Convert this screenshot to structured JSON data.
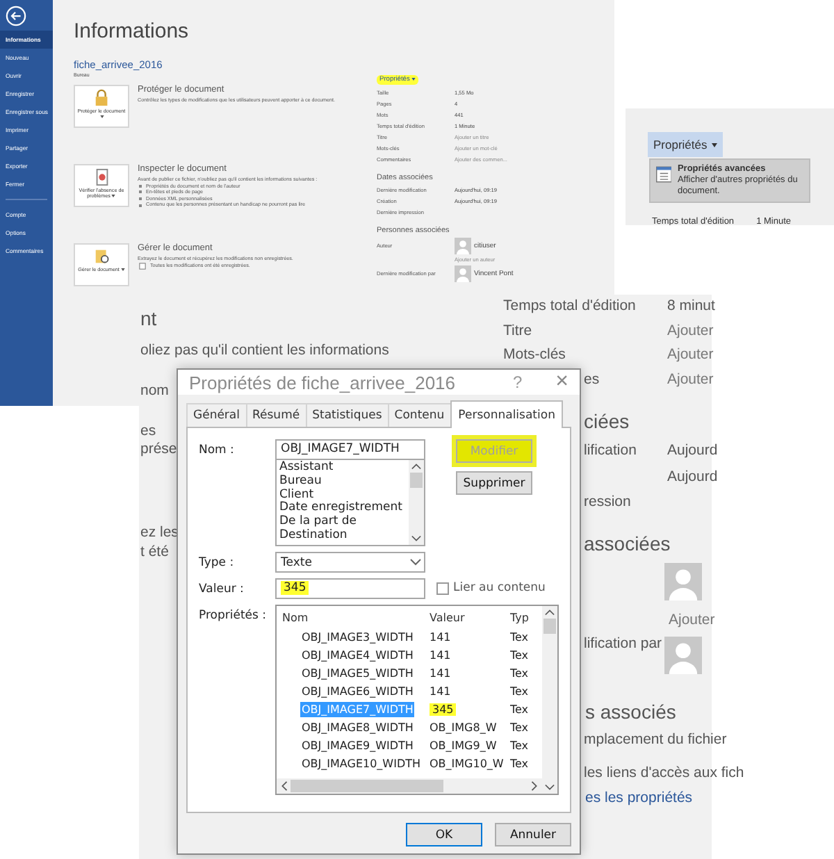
{
  "backstage": {
    "sidebar": {
      "items": [
        {
          "label": "Informations",
          "selected": true
        },
        {
          "label": "Nouveau",
          "selected": false
        },
        {
          "label": "Ouvrir",
          "selected": false
        },
        {
          "label": "Enregistrer",
          "selected": false
        },
        {
          "label": "Enregistrer sous",
          "selected": false
        },
        {
          "label": "Imprimer",
          "selected": false
        },
        {
          "label": "Partager",
          "selected": false
        },
        {
          "label": "Exporter",
          "selected": false
        },
        {
          "label": "Fermer",
          "selected": false
        },
        {
          "label": "Compte",
          "selected": false
        },
        {
          "label": "Options",
          "selected": false
        },
        {
          "label": "Commentaires",
          "selected": false
        }
      ]
    },
    "title": "Informations",
    "file_name": "fiche_arrivee_2016",
    "location": "Bureau",
    "sections": [
      {
        "kind": "protect",
        "button_label": "Protéger le document",
        "heading": "Protéger le document",
        "description": "Contrôlez les types de modifications que les utilisateurs peuvent apporter à ce document."
      },
      {
        "kind": "inspect",
        "button_label": "Vérifier l'absence de problèmes",
        "heading": "Inspecter le document",
        "description": "Avant de publier ce fichier, n'oubliez pas qu'il contient les informations suivantes :",
        "bullets": [
          "Propriétés du document et nom de l'auteur",
          "En-têtes et pieds de page",
          "Données XML personnalisées",
          "Contenu que les personnes présentant un handicap ne pourront pas lire"
        ]
      },
      {
        "kind": "manage",
        "button_label": "Gérer le document",
        "heading": "Gérer le document",
        "description": "Extrayez le document et récupérez les modifications non enregistrées.",
        "note": "Toutes les modifications ont été enregistrées."
      }
    ],
    "properties": {
      "heading": "Propriétés",
      "highlighted": true,
      "rows": [
        {
          "label": "Taille",
          "value": "1,55 Mo",
          "muted": false
        },
        {
          "label": "Pages",
          "value": "4",
          "muted": false
        },
        {
          "label": "Mots",
          "value": "441",
          "muted": false
        },
        {
          "label": "Temps total d'édition",
          "value": "1 Minute",
          "muted": false
        },
        {
          "label": "Titre",
          "value": "Ajouter un titre",
          "muted": true
        },
        {
          "label": "Mots-clés",
          "value": "Ajouter un mot-clé",
          "muted": true
        },
        {
          "label": "Commentaires",
          "value": "Ajouter des commen...",
          "muted": true
        }
      ]
    },
    "dates": {
      "heading": "Dates associées",
      "rows": [
        {
          "label": "Dernière modification",
          "value": "Aujourd'hui, 09:19"
        },
        {
          "label": "Création",
          "value": "Aujourd'hui, 09:19"
        },
        {
          "label": "Dernière impression"
        }
      ]
    },
    "people": {
      "heading": "Personnes associées",
      "author_label": "Auteur",
      "author": "citiuser",
      "add_author": "Ajouter un auteur",
      "modified_by_label": "Dernière modification par",
      "modified_by": "Vincent Pont"
    }
  },
  "properties_menu": {
    "button": "Propriétés",
    "item_title": "Propriétés avancées",
    "item_description": "Afficher d'autres propriétés du document.",
    "row_label": "Temps total d'édition",
    "row_value": "1 Minute"
  },
  "backstage_zoomed": {
    "left_texts": [
      {
        "text": "nt",
        "kind": "heading"
      },
      {
        "text": "oliez pas qu'il contient les informations",
        "kind": "label"
      },
      {
        "text": "nom",
        "kind": "label"
      },
      {
        "text": "es",
        "kind": "label"
      },
      {
        "text": "prése",
        "kind": "label"
      },
      {
        "text": "ez les",
        "kind": "label"
      },
      {
        "text": "t été",
        "kind": "label"
      }
    ],
    "right_texts": [
      {
        "text": "Temps total d'édition",
        "kind": "label"
      },
      {
        "text": "8 minut",
        "kind": "label"
      },
      {
        "text": "Titre",
        "kind": "label"
      },
      {
        "text": "Ajouter",
        "kind": "muted"
      },
      {
        "text": "Mots-clés",
        "kind": "label"
      },
      {
        "text": "Ajouter",
        "kind": "muted"
      },
      {
        "text": "es",
        "kind": "label"
      },
      {
        "text": "Ajouter",
        "kind": "muted"
      },
      {
        "text": "ciées",
        "kind": "heading"
      },
      {
        "text": "lification",
        "kind": "label"
      },
      {
        "text": "Aujourd",
        "kind": "label"
      },
      {
        "text": "Aujourd",
        "kind": "label"
      },
      {
        "text": "ression",
        "kind": "label"
      },
      {
        "text": "associées",
        "kind": "heading"
      },
      {
        "text": "Ajouter",
        "kind": "muted"
      },
      {
        "text": "lification par",
        "kind": "label"
      },
      {
        "text": "s associés",
        "kind": "heading"
      },
      {
        "text": "mplacement du fichier",
        "kind": "label"
      },
      {
        "text": "les liens d'accès aux fich",
        "kind": "label"
      },
      {
        "text": "es les propriétés",
        "kind": "link"
      }
    ]
  },
  "dialog": {
    "title": "Propriétés de fiche_arrivee_2016",
    "help": "?",
    "close": "×",
    "tabs": [
      {
        "label": "Général",
        "selected": false
      },
      {
        "label": "Résumé",
        "selected": false
      },
      {
        "label": "Statistiques",
        "selected": false
      },
      {
        "label": "Contenu",
        "selected": false
      },
      {
        "label": "Personnalisation",
        "selected": true
      }
    ],
    "name_label": "Nom :",
    "name_value": "OBJ_IMAGE7_WIDTH",
    "name_options": [
      "Assistant",
      "Bureau",
      "Client",
      "Date enregistrement",
      "De la part de",
      "Destination"
    ],
    "buttons": [
      {
        "label": "Modifier",
        "disabled": true,
        "highlighted": true
      },
      {
        "label": "Supprimer",
        "disabled": false,
        "highlighted": false
      }
    ],
    "type_label": "Type :",
    "type_value": "Texte",
    "value_label": "Valeur :",
    "value": "345",
    "value_highlighted": true,
    "link": {
      "label": "Lier au contenu",
      "checked": false
    },
    "properties_label": "Propriétés :",
    "table": {
      "columns": [
        "Nom",
        "Valeur",
        "Typ"
      ],
      "rows": [
        {
          "name": "OBJ_IMAGE3_WIDTH",
          "value": "141",
          "type": "Tex",
          "selected": false,
          "highlighted": false
        },
        {
          "name": "OBJ_IMAGE4_WIDTH",
          "value": "141",
          "type": "Tex",
          "selected": false,
          "highlighted": false
        },
        {
          "name": "OBJ_IMAGE5_WIDTH",
          "value": "141",
          "type": "Tex",
          "selected": false,
          "highlighted": false
        },
        {
          "name": "OBJ_IMAGE6_WIDTH",
          "value": "141",
          "type": "Tex",
          "selected": false,
          "highlighted": false
        },
        {
          "name": "OBJ_IMAGE7_WIDTH",
          "value": "345",
          "type": "Tex",
          "selected": true,
          "highlighted": true
        },
        {
          "name": "OBJ_IMAGE8_WIDTH",
          "value": "OB_IMG8_W",
          "type": "Tex",
          "selected": false,
          "highlighted": false
        },
        {
          "name": "OBJ_IMAGE9_WIDTH",
          "value": "OB_IMG9_W",
          "type": "Tex",
          "selected": false,
          "highlighted": false
        },
        {
          "name": "OBJ_IMAGE10_WIDTH",
          "value": "OB_IMG10_W",
          "type": "Tex",
          "selected": false,
          "highlighted": false
        }
      ]
    },
    "ok": "OK",
    "cancel": "Annuler"
  }
}
